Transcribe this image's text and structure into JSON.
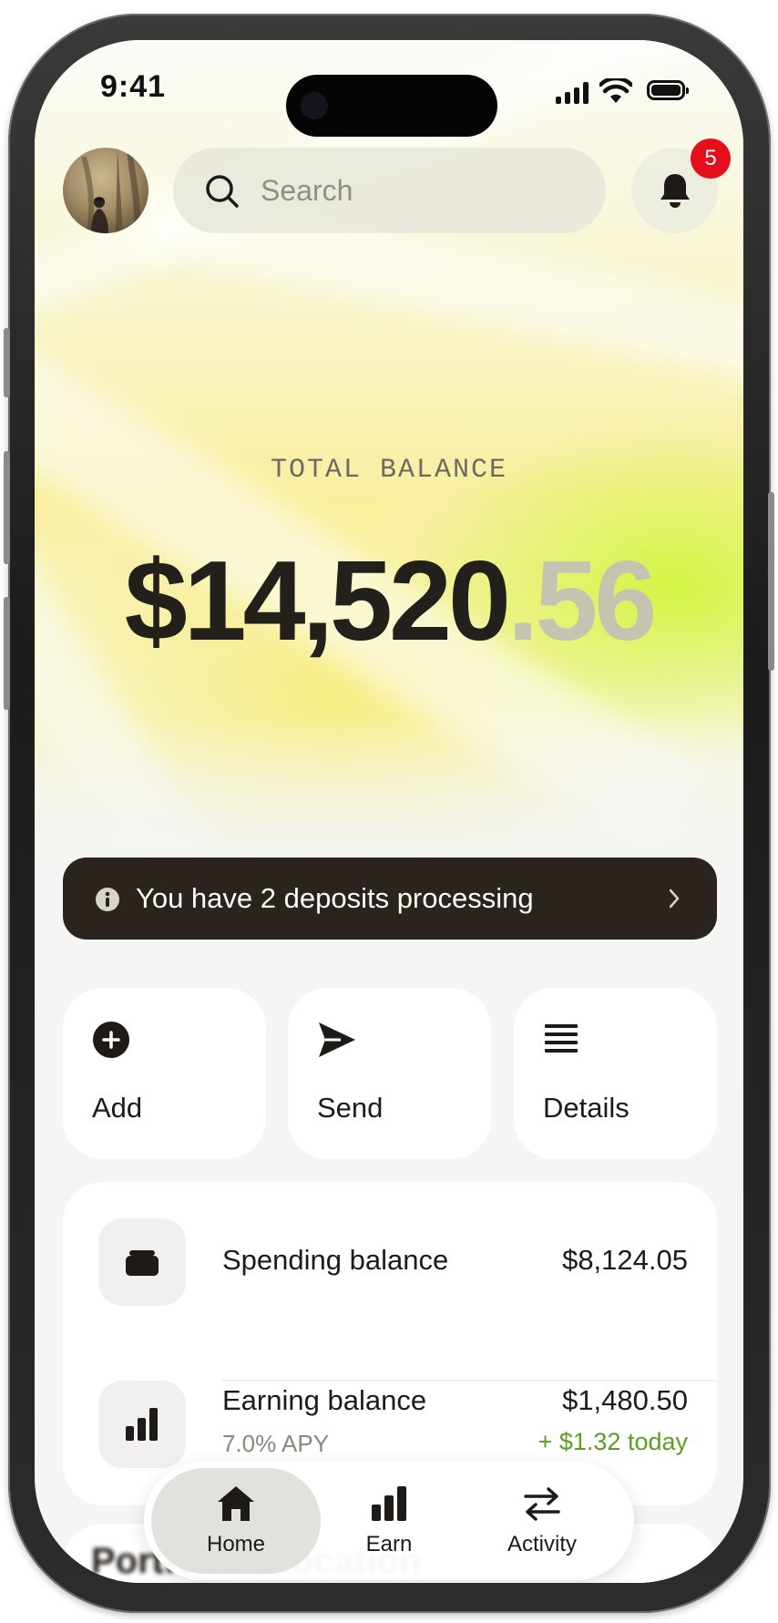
{
  "status_bar": {
    "time": "9:41"
  },
  "header": {
    "search_placeholder": "Search",
    "notifications_count": "5"
  },
  "balance": {
    "label": "TOTAL BALANCE",
    "amount_whole": "$14,520",
    "amount_cents": ".56"
  },
  "banner": {
    "text": "You have 2 deposits processing"
  },
  "actions": [
    {
      "label": "Add",
      "icon": "plus-circle-icon"
    },
    {
      "label": "Send",
      "icon": "send-icon"
    },
    {
      "label": "Details",
      "icon": "list-icon"
    }
  ],
  "balances": [
    {
      "title": "Spending balance",
      "amount": "$8,124.05",
      "icon": "wallet-icon"
    },
    {
      "title": "Earning balance",
      "amount": "$1,480.50",
      "subtitle": "7.0% APY",
      "change": "+ $1.32 today",
      "icon": "bar-chart-icon"
    }
  ],
  "portfolio": {
    "title": "Portfolio allocation"
  },
  "tabbar": {
    "tabs": [
      {
        "label": "Home",
        "icon": "home-icon",
        "active": true
      },
      {
        "label": "Earn",
        "icon": "bar-chart-icon"
      },
      {
        "label": "Activity",
        "icon": "swap-arrows-icon"
      }
    ]
  },
  "colors": {
    "banner_bg": "#2a231e",
    "badge": "#e50f1b",
    "positive": "#5c9e21",
    "accent_glow": "#d2f53c"
  }
}
